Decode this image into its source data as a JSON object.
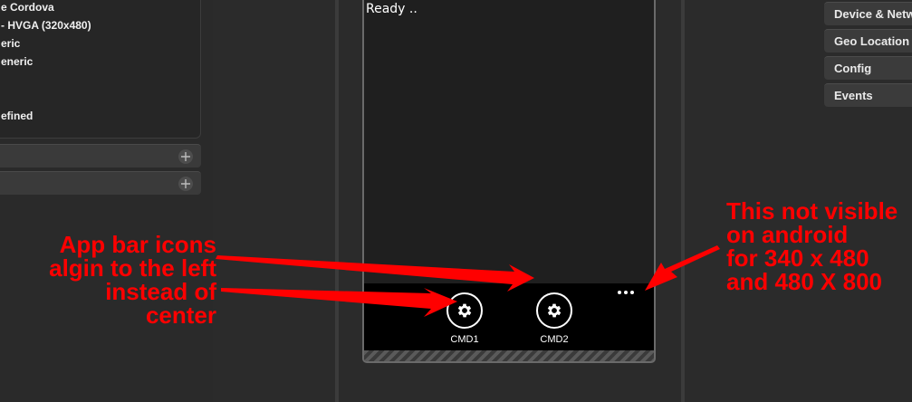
{
  "left_panel": {
    "info_lines": [
      "e Cordova",
      "- HVGA (320x480)",
      "eric",
      "eneric",
      "efined"
    ]
  },
  "phone": {
    "status_text": "Ready ..",
    "appbar": {
      "buttons": [
        {
          "label": "CMD1",
          "icon": "gear-icon"
        },
        {
          "label": "CMD2",
          "icon": "gear-icon"
        }
      ],
      "more_icon": "ellipsis-icon"
    }
  },
  "right_panel": {
    "buttons": [
      "Device & Netw",
      "Geo Location",
      "Config",
      "Events"
    ]
  },
  "annotations": {
    "left": [
      "App bar icons",
      "algin to the left",
      "instead of",
      "center"
    ],
    "right": [
      "This not visible",
      "on android",
      "for 340 x 480",
      "and 480 X 800"
    ]
  },
  "colors": {
    "annotation": "#ff0000",
    "background": "#2b2b2b",
    "appbar": "#000000"
  }
}
